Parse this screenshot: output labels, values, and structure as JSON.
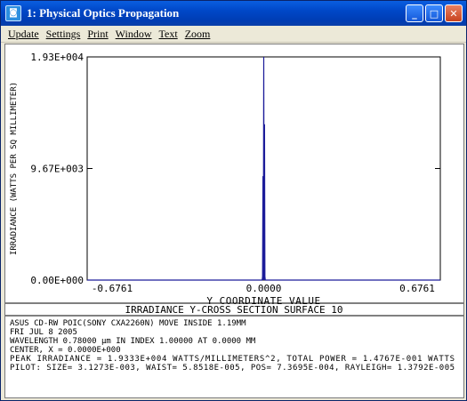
{
  "window": {
    "title": "1: Physical Optics Propagation",
    "icon": "app-icon",
    "buttons": [
      "minimize",
      "maximize",
      "close"
    ]
  },
  "menu": {
    "items": [
      "Update",
      "Settings",
      "Print",
      "Window",
      "Text",
      "Zoom"
    ]
  },
  "chart_data": {
    "type": "line",
    "xlabel": "Y COORDINATE VALUE",
    "ylabel": "IRRADIANCE (WATTS PER SQ MILLIMETER)",
    "x_tick_labels": [
      "-0.6761",
      "0.0000",
      "0.6761"
    ],
    "y_tick_labels": [
      "1.93E+004",
      "9.67E+003",
      "0.00E+000"
    ],
    "xlim": [
      -0.6761,
      0.6761
    ],
    "ylim": [
      0,
      19333
    ],
    "series": [
      {
        "color": "#1c1c9a",
        "x": [
          -0.6761,
          -0.006,
          -0.0045,
          -0.003,
          -0.0015,
          0.0,
          0.0015,
          0.003,
          0.0045,
          0.006,
          0.6761
        ],
        "y": [
          0,
          0,
          300,
          9000,
          0,
          19333,
          0,
          13500,
          300,
          0,
          0
        ]
      }
    ]
  },
  "info": {
    "heading": "IRRADIANCE Y-CROSS SECTION SURFACE 10",
    "lines": [
      "ASUS CD-RW POIC(SONY CXA2260N) MOVE INSIDE 1.19MM",
      "FRI JUL 8 2005",
      "WAVELENGTH 0.78000 µm IN INDEX 1.00000 AT 0.0000 MM",
      "CENTER, X = 0.0000E+000",
      "PEAK IRRADIANCE = 1.9333E+004 WATTS/MILLIMETERS^2, TOTAL POWER = 1.4767E-001 WATTS",
      "PILOT: SIZE= 3.1273E-003, WAIST= 5.8518E-005, POS= 7.3695E-004, RAYLEIGH= 1.3792E-005"
    ]
  }
}
